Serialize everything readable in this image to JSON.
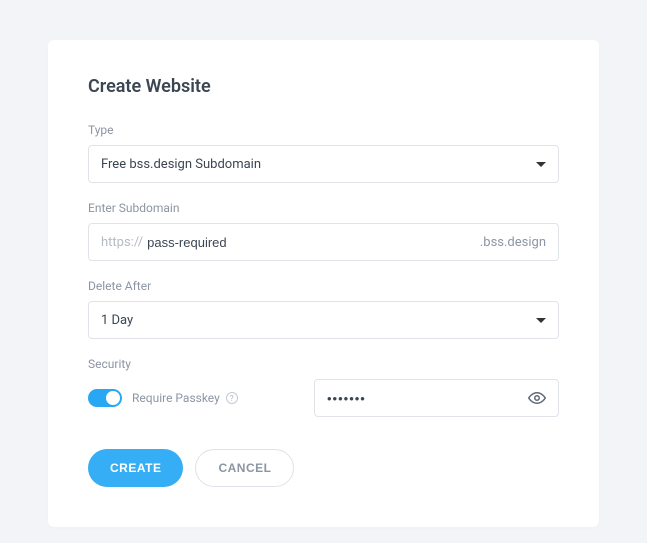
{
  "title": "Create Website",
  "fields": {
    "type": {
      "label": "Type",
      "value": "Free bss.design Subdomain"
    },
    "subdomain": {
      "label": "Enter Subdomain",
      "prefix": "https://",
      "value": "pass-required",
      "suffix": ".bss.design"
    },
    "delete_after": {
      "label": "Delete After",
      "value": "1 Day"
    },
    "security": {
      "label": "Security",
      "toggle_label": "Require Passkey",
      "toggle_on": true,
      "pass_value": "•••••••"
    }
  },
  "buttons": {
    "create": "CREATE",
    "cancel": "CANCEL"
  }
}
